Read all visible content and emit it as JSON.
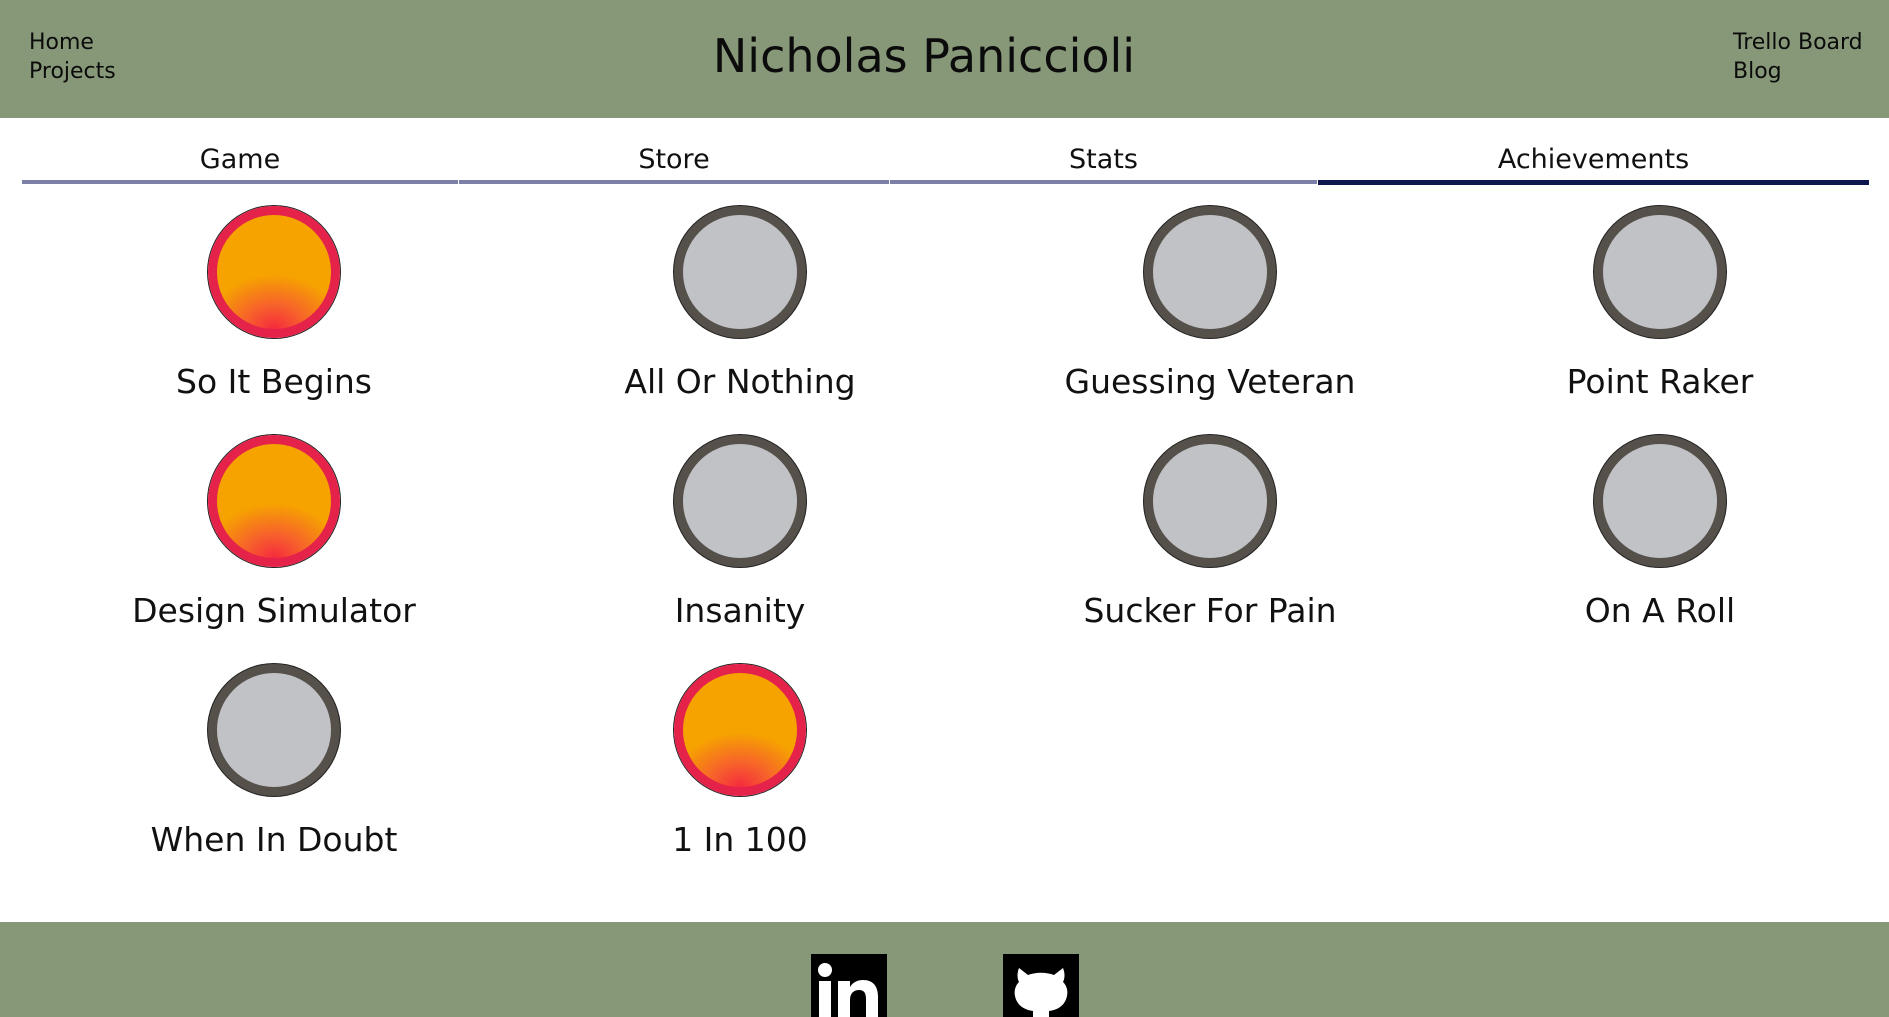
{
  "header": {
    "title": "Nicholas Paniccioli",
    "nav_left": [
      "Home",
      "Projects"
    ],
    "nav_right": [
      "Trello Board",
      "Blog"
    ],
    "background": "#879879"
  },
  "tabs": [
    {
      "label": "Game",
      "active": false
    },
    {
      "label": "Store",
      "active": false
    },
    {
      "label": "Stats",
      "active": false
    },
    {
      "label": "Achievements",
      "active": true
    }
  ],
  "colors": {
    "tab_underline": "#7c80a8",
    "tab_active_underline": "#0e1650",
    "badge_locked_fill": "#c0c2c6",
    "badge_locked_ring": "#55504a",
    "badge_unlocked_ring": "#e5234a",
    "badge_unlocked_fill": "#f6a300"
  },
  "achievements": [
    {
      "name": "So It Begins",
      "unlocked": true
    },
    {
      "name": "All Or Nothing",
      "unlocked": false
    },
    {
      "name": "Guessing Veteran",
      "unlocked": false
    },
    {
      "name": "Point Raker",
      "unlocked": false
    },
    {
      "name": "Design Simulator",
      "unlocked": true
    },
    {
      "name": "Insanity",
      "unlocked": false
    },
    {
      "name": "Sucker For Pain",
      "unlocked": false
    },
    {
      "name": "On A Roll",
      "unlocked": false
    },
    {
      "name": "When In Doubt",
      "unlocked": false
    },
    {
      "name": "1 In 100",
      "unlocked": true
    }
  ],
  "footer": {
    "icons": [
      "linkedin-icon",
      "github-icon"
    ]
  }
}
